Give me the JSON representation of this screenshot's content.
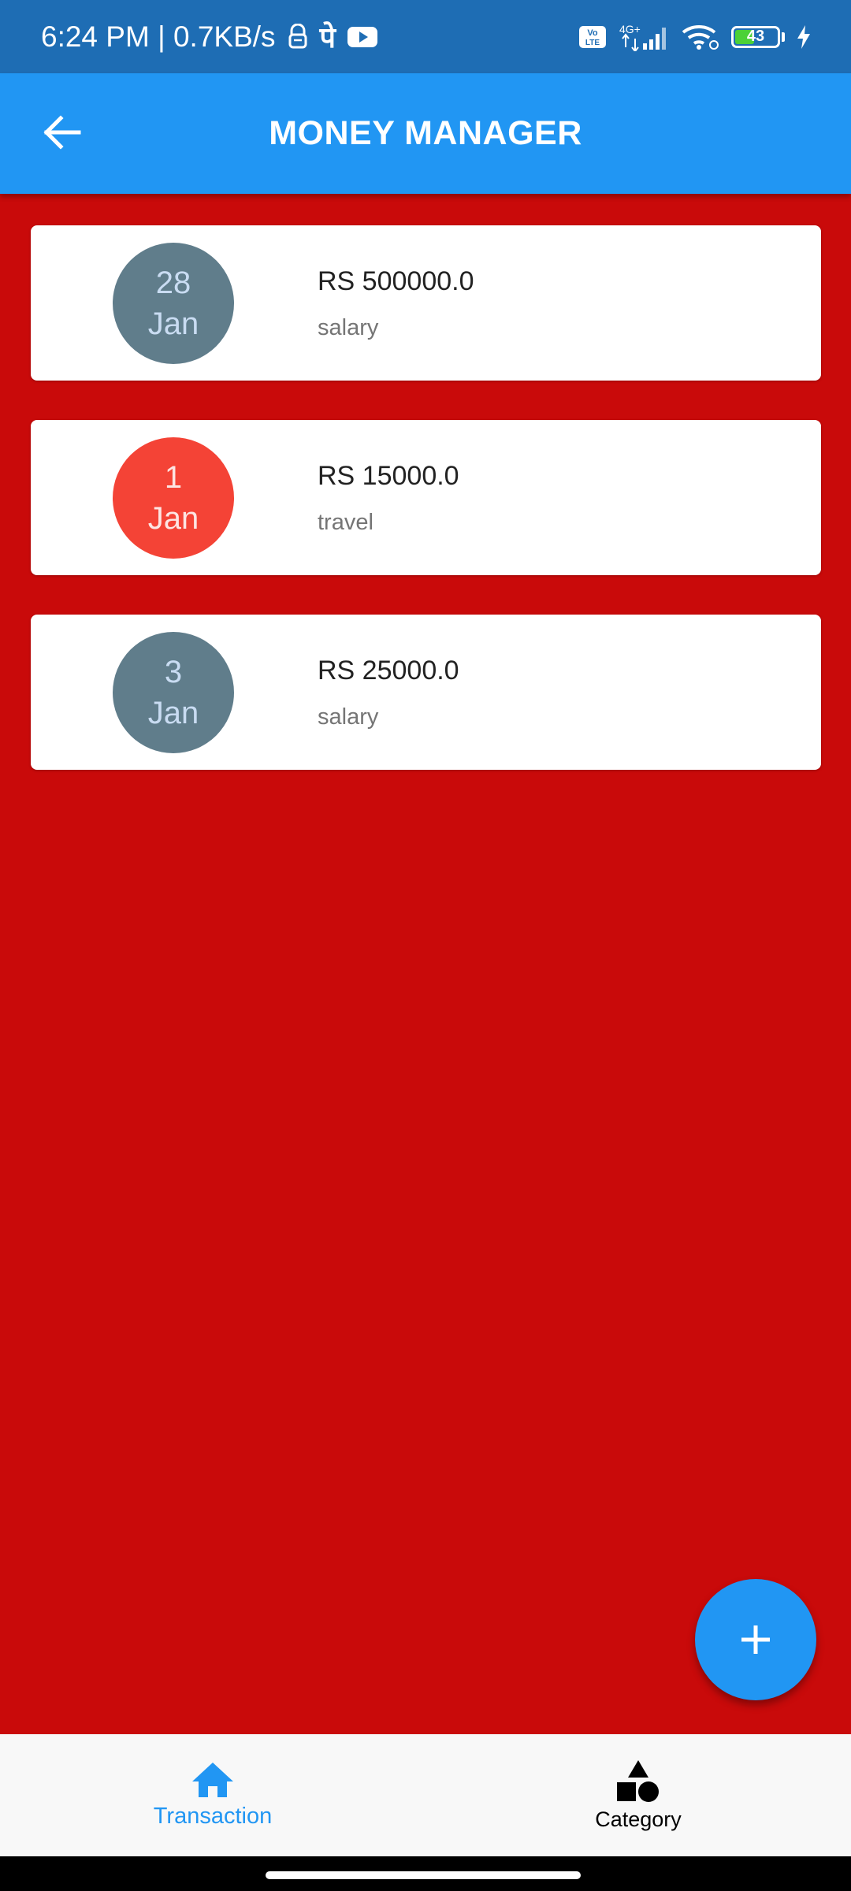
{
  "status_bar": {
    "time_speed": "6:24 PM | 0.7KB/s",
    "network_label": "4G+",
    "volte_label": "Vo\nLTE",
    "battery": "43"
  },
  "app_bar": {
    "title": "MONEY MANAGER"
  },
  "transactions": [
    {
      "day": "28",
      "month": "Jan",
      "amount": "RS 500000.0",
      "category": "salary",
      "type": "income"
    },
    {
      "day": "1",
      "month": "Jan",
      "amount": "RS 15000.0",
      "category": "travel",
      "type": "expense"
    },
    {
      "day": "3",
      "month": "Jan",
      "amount": "RS 25000.0",
      "category": "salary",
      "type": "income"
    }
  ],
  "bottom_nav": {
    "transaction_label": "Transaction",
    "category_label": "Category"
  },
  "colors": {
    "status_bar": "#1e6db4",
    "app_bar": "#2196f3",
    "background": "#c90a0a",
    "income_circle": "#607d8b",
    "expense_circle": "#f44336",
    "active_nav": "#2196f3"
  },
  "icons": {
    "back": "arrow-left-icon",
    "fab": "plus-icon",
    "transaction": "home-icon",
    "category": "shapes-icon"
  }
}
